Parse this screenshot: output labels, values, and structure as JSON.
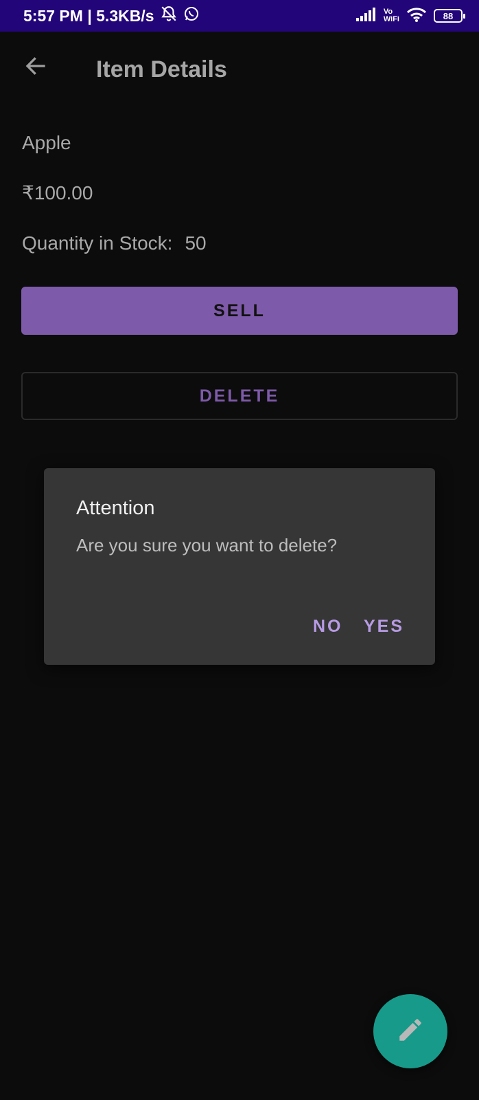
{
  "status_bar": {
    "time_speed": "5:57 PM | 5.3KB/s",
    "vo_label": "Vo",
    "wifi_label": "WiFi",
    "battery": "88"
  },
  "toolbar": {
    "title": "Item Details"
  },
  "item": {
    "name": "Apple",
    "price": "₹100.00",
    "stock_label": "Quantity in Stock:",
    "stock_value": "50"
  },
  "actions": {
    "sell_label": "SELL",
    "delete_label": "DELETE"
  },
  "dialog": {
    "title": "Attention",
    "message": "Are you sure you want to delete?",
    "no_label": "NO",
    "yes_label": "YES"
  },
  "colors": {
    "status_bar": "#23057a",
    "accent": "#7e5aaa",
    "fab": "#179a8a",
    "background": "#0c0c0c"
  },
  "icons": {
    "back": "arrow-left-icon",
    "fab": "pencil-icon",
    "mute": "bell-off-icon",
    "whatsapp": "whatsapp-icon",
    "signal": "signal-icon",
    "wifi": "wifi-icon",
    "battery": "battery-icon"
  }
}
